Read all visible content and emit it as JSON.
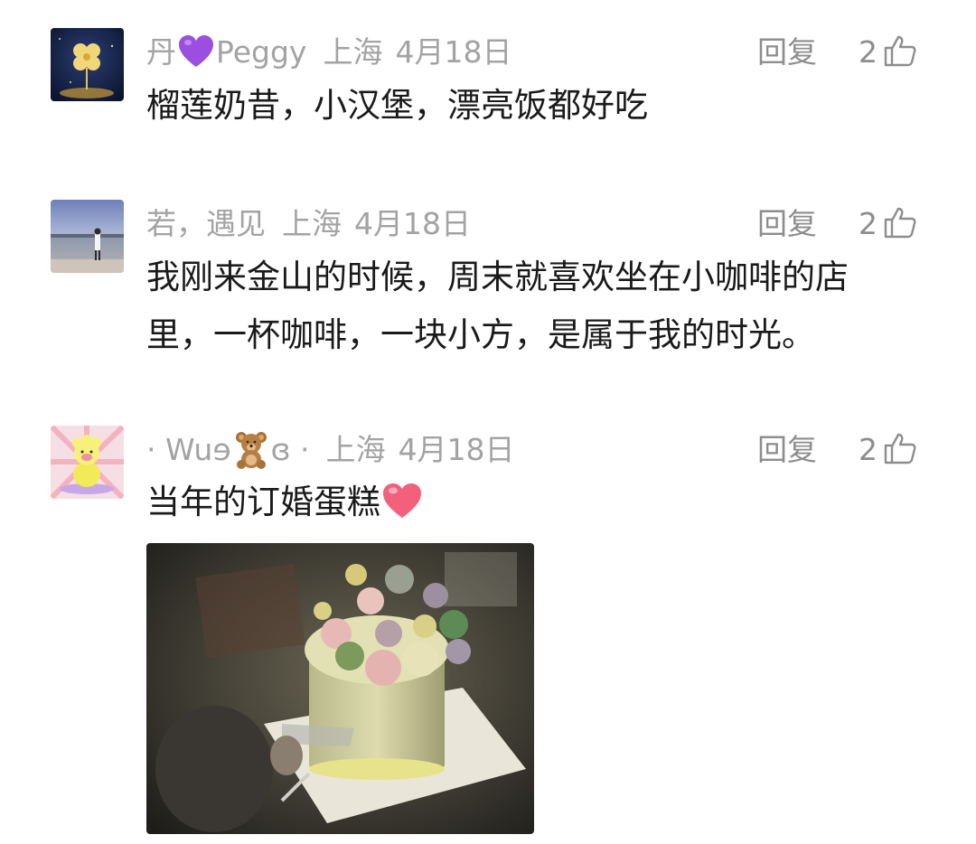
{
  "comments": [
    {
      "nickname": "丹",
      "nickname_suffix": "Peggy",
      "nickname_emoji": "purple-heart",
      "location": "上海",
      "date": "4月18日",
      "reply_label": "回复",
      "likes": "2",
      "text": "榴莲奶昔，小汉堡，漂亮饭都好吃"
    },
    {
      "nickname": "若，遇见",
      "location": "上海",
      "date": "4月18日",
      "reply_label": "回复",
      "likes": "2",
      "text_line1": "我刚来金山的时候，周末就喜欢坐在小咖啡的店",
      "text_line2": "里，一杯咖啡，一块小方，是属于我的时光。"
    },
    {
      "nickname": "· Wuɘ",
      "nickname_emoji": "teddy-bear",
      "nickname_suffix": "ɞ  ·",
      "location": "上海",
      "date": "4月18日",
      "reply_label": "回复",
      "likes": "2",
      "text": "当年的订婚蛋糕",
      "text_emoji": "pink-heart",
      "has_photo": true
    }
  ],
  "colors": {
    "meta_gray": "#a3a3a3",
    "action_gray": "#8d8d8d",
    "text": "#1a1a1a",
    "purple_heart": "#9b4fe0",
    "pink_heart": "#f2607c"
  }
}
